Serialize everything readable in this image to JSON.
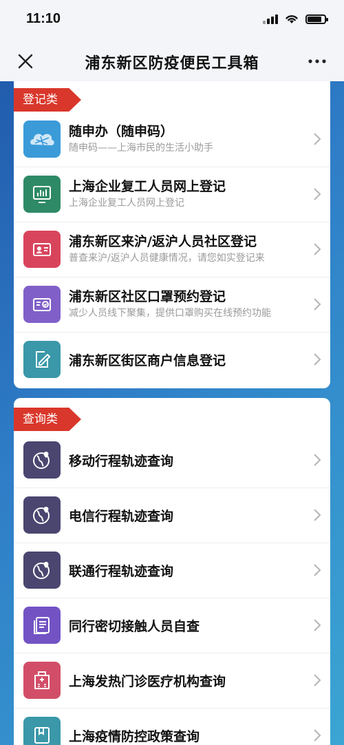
{
  "status_bar": {
    "time": "11:10"
  },
  "nav": {
    "title": "浦东新区防疫便民工具箱"
  },
  "colors": {
    "ribbon": "#d9372b",
    "icon_blue": "#3b9bd9",
    "icon_green": "#2e8a66",
    "icon_red": "#d9445d",
    "icon_purple": "#8060c8",
    "icon_teal": "#3a98a8",
    "icon_indigo": "#4a4670",
    "icon_violet": "#7353c4",
    "icon_pink": "#d24e68"
  },
  "registration": {
    "tag": "登记类",
    "items": [
      {
        "title": "随申办（随申码）",
        "subtitle": "随申码——上海市民的生活小助手",
        "icon": "cloud-map-icon"
      },
      {
        "title": "上海企业复工人员网上登记",
        "subtitle": "上海企业复工人员网上登记",
        "icon": "chart-monitor-icon"
      },
      {
        "title": "浦东新区来沪/返沪人员社区登记",
        "subtitle": "普查来沪/返沪人员健康情况，请您如实登记来",
        "icon": "id-card-icon"
      },
      {
        "title": "浦东新区社区口罩预约登记",
        "subtitle": "减少人员线下聚集，提供口罩购买在线预约功能",
        "icon": "checked-card-icon"
      },
      {
        "title": "浦东新区街区商户信息登记",
        "subtitle": "",
        "icon": "edit-form-icon"
      }
    ]
  },
  "query": {
    "tag": "查询类",
    "items": [
      {
        "title": "移动行程轨迹查询",
        "icon": "globe-route-icon"
      },
      {
        "title": "电信行程轨迹查询",
        "icon": "globe-route-icon"
      },
      {
        "title": "联通行程轨迹查询",
        "icon": "globe-route-icon"
      },
      {
        "title": "同行密切接触人员自查",
        "icon": "document-list-icon"
      },
      {
        "title": "上海发热门诊医疗机构查询",
        "icon": "hospital-icon"
      },
      {
        "title": "上海疫情防控政策查询",
        "icon": "policy-book-icon"
      }
    ]
  }
}
